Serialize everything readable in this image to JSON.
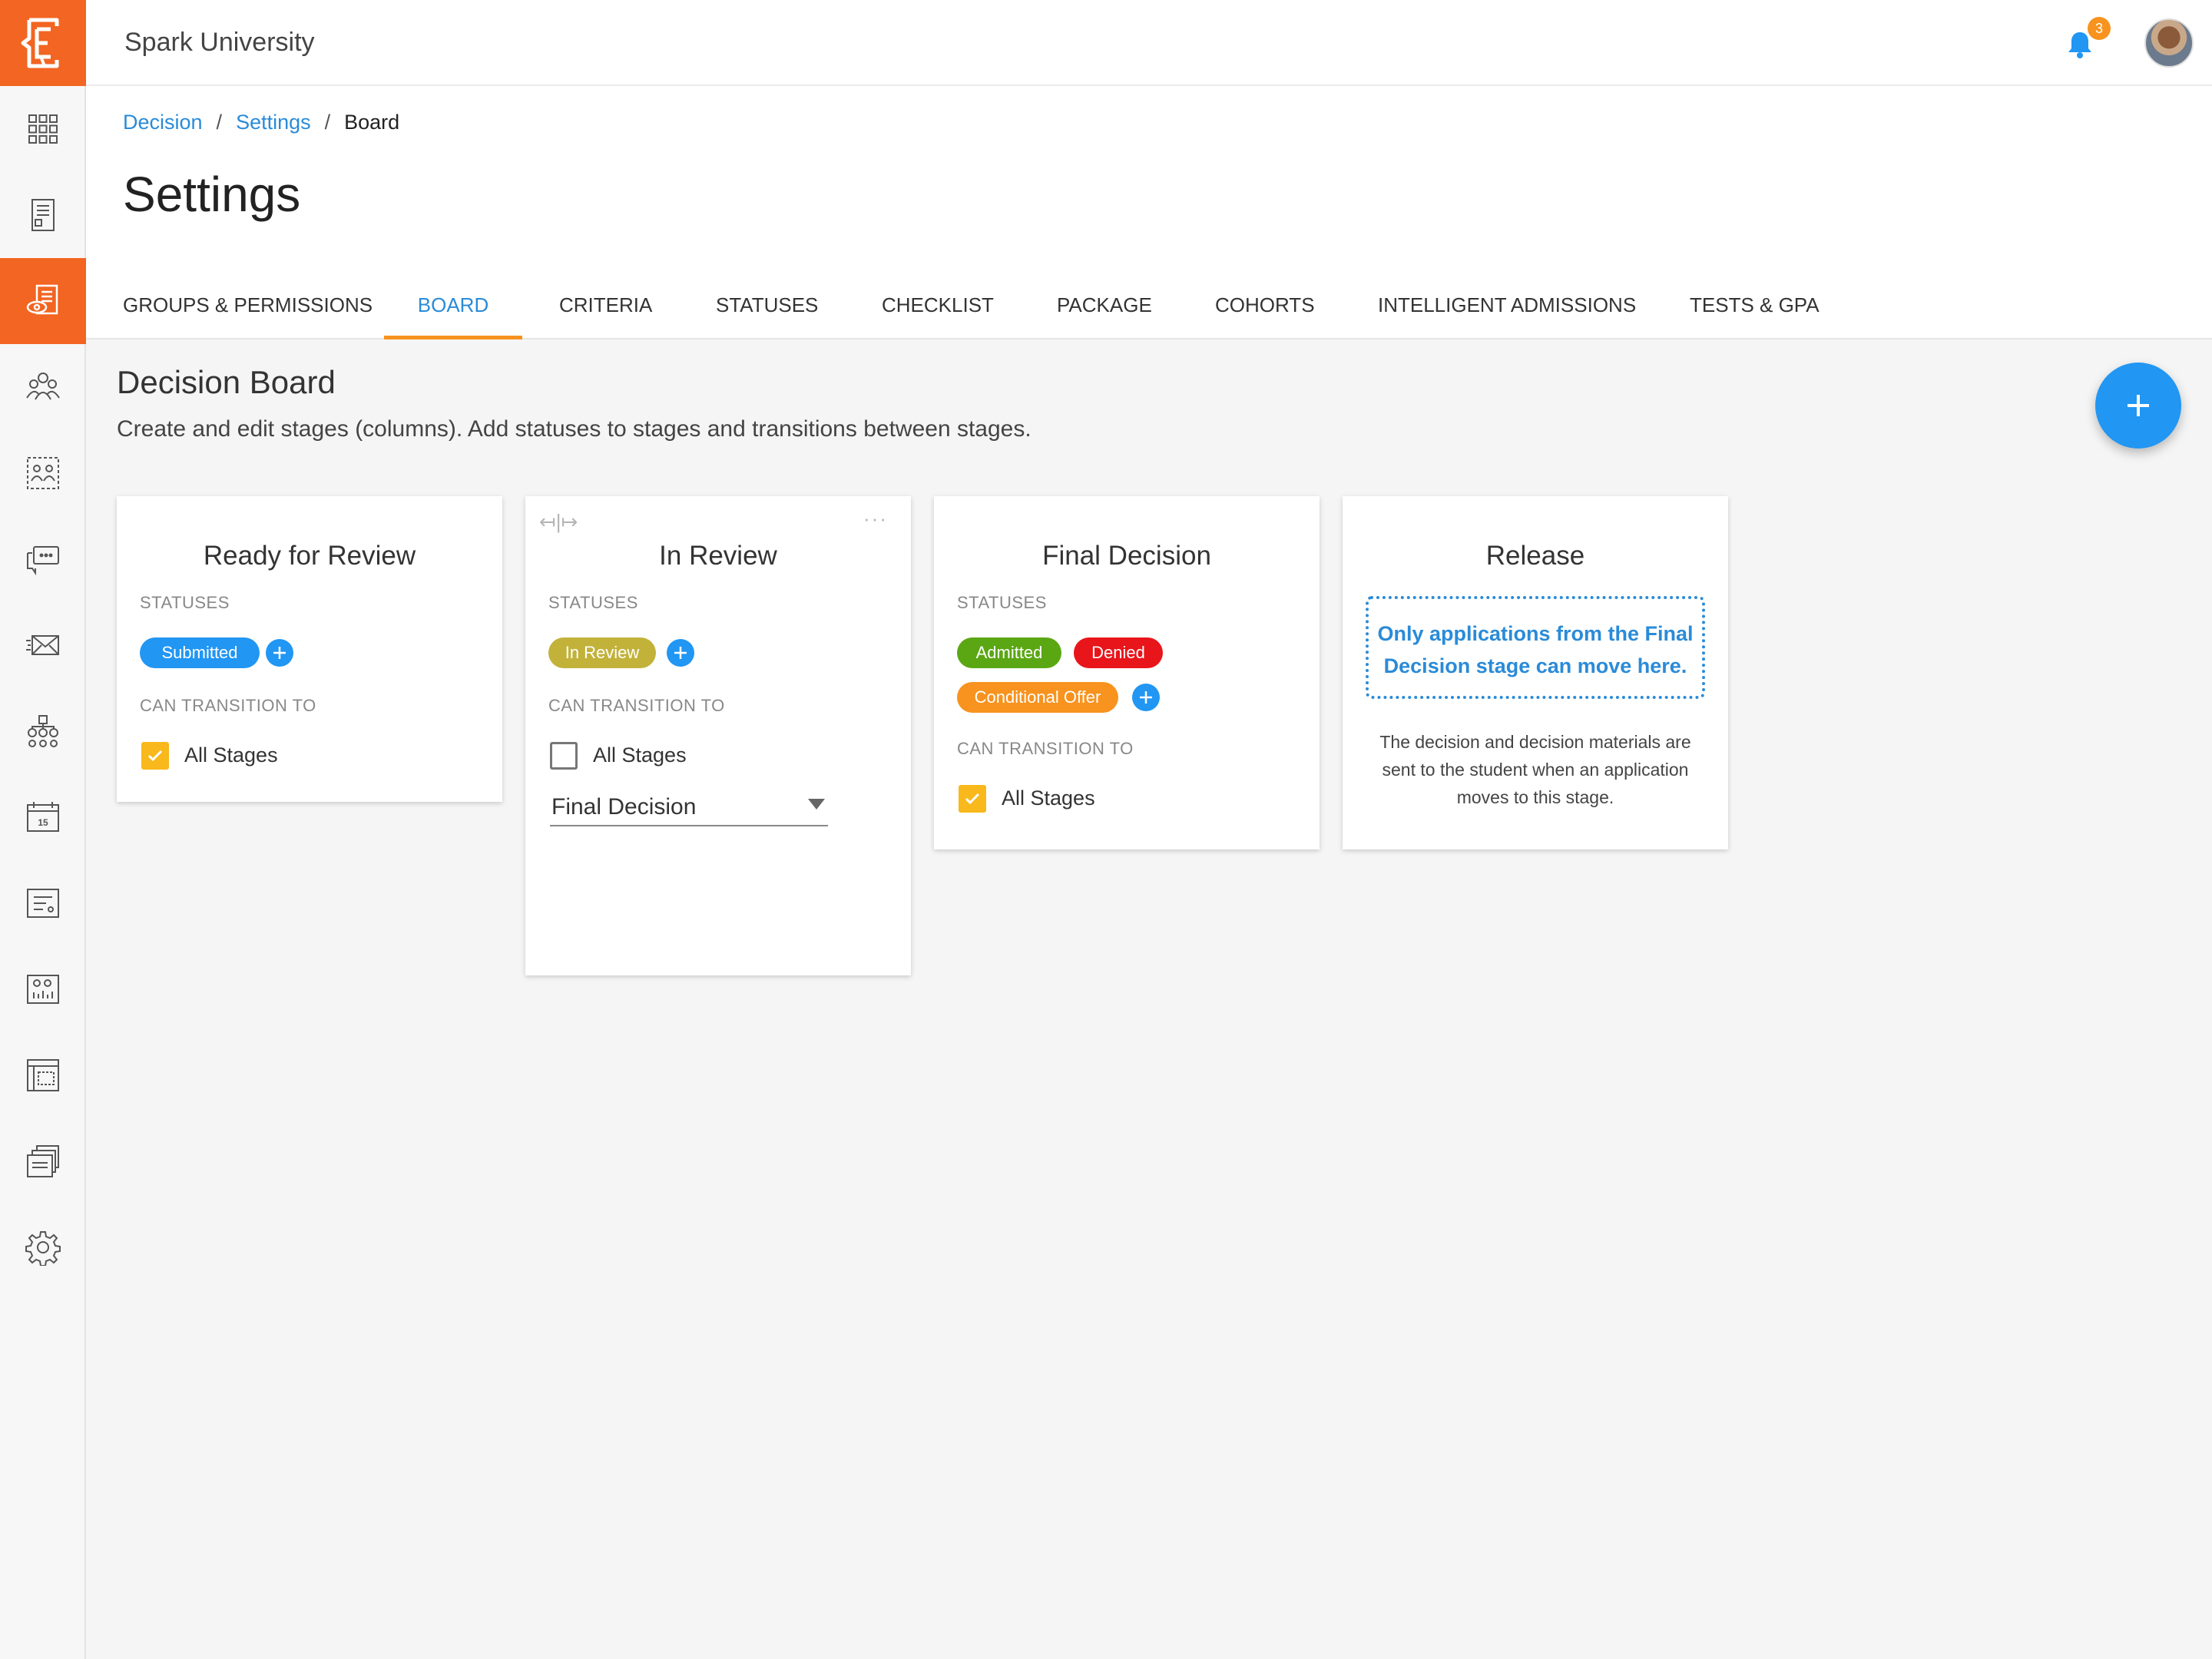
{
  "app": {
    "title": "Spark University",
    "notification_count": "3"
  },
  "breadcrumb": {
    "items": [
      "Decision",
      "Settings"
    ],
    "current": "Board",
    "separator": "/"
  },
  "page": {
    "title": "Settings"
  },
  "tabs": [
    {
      "label": "Groups & Permissions",
      "active": false
    },
    {
      "label": "Board",
      "active": true
    },
    {
      "label": "Criteria",
      "active": false
    },
    {
      "label": "Statuses",
      "active": false
    },
    {
      "label": "Checklist",
      "active": false
    },
    {
      "label": "Package",
      "active": false
    },
    {
      "label": "Cohorts",
      "active": false
    },
    {
      "label": "Intelligent Admissions",
      "active": false
    },
    {
      "label": "Tests & GPA",
      "active": false
    }
  ],
  "section": {
    "title": "Decision Board",
    "description": "Create and edit stages (columns). Add statuses to stages and transitions between stages."
  },
  "labels": {
    "statuses": "Statuses",
    "can_transition_to": "Can Transition To",
    "all_stages": "All Stages"
  },
  "stages": [
    {
      "title": "Ready for Review",
      "statuses": [
        {
          "label": "Submitted",
          "color": "#2196f3"
        }
      ],
      "all_stages_checked": true
    },
    {
      "title": "In Review",
      "statuses": [
        {
          "label": "In Review",
          "color": "#c2b23a"
        }
      ],
      "all_stages_checked": false,
      "transition_select": "Final Decision",
      "drag_icon": "↤|↦",
      "menu_icon": "···"
    },
    {
      "title": "Final Decision",
      "statuses": [
        {
          "label": "Admitted",
          "color": "#5aa713"
        },
        {
          "label": "Denied",
          "color": "#e8151b"
        },
        {
          "label": "Conditional Offer",
          "color": "#f7931e"
        }
      ],
      "all_stages_checked": true
    },
    {
      "title": "Release",
      "note": "Only applications from the Final Decision stage can move here.",
      "description": "The decision and decision materials are sent to the student when an application moves to this stage."
    }
  ],
  "colors": {
    "brand": "#f26522",
    "accent": "#2a8bd8",
    "fab": "#2196f3",
    "tab_indicator": "#f7931e",
    "checkbox": "#f9b81b"
  },
  "icons": {
    "sidebar": [
      "dashboard-grid-icon",
      "application-icon",
      "review-icon",
      "people-icon",
      "groups-icon",
      "messages-icon",
      "email-icon",
      "workflow-icon",
      "calendar-icon",
      "forms-icon",
      "reports-icon",
      "templates-icon",
      "documents-icon",
      "gear-icon"
    ],
    "topbar": [
      "bell-icon",
      "avatar"
    ]
  }
}
